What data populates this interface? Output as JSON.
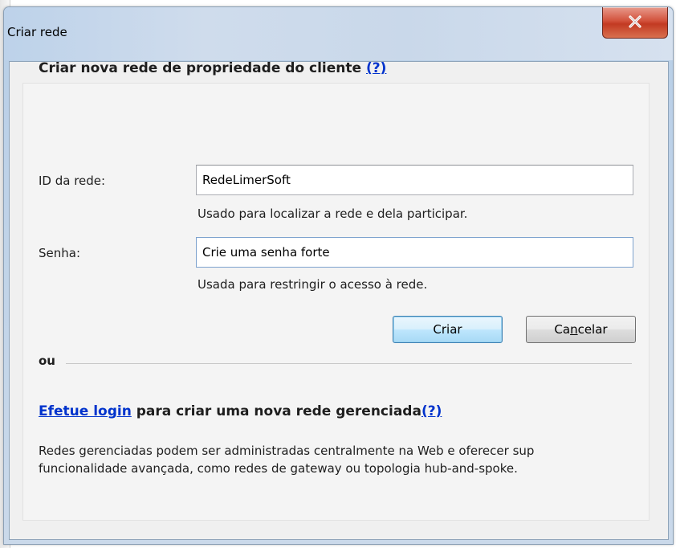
{
  "window": {
    "title": "Criar rede",
    "close_icon": "close-icon"
  },
  "form": {
    "heading": "Criar nova rede de propriedade do cliente",
    "heading_help": "(?)",
    "network_id_label": "ID da rede:",
    "network_id_value": "RedeLimerSoft",
    "network_id_hint": "Usado para localizar a rede e dela participar.",
    "password_label": "Senha:",
    "password_value": "Crie uma senha forte",
    "password_hint": "Usada para restringir o acesso à rede.",
    "create_button": "Criar",
    "cancel_button_prefix": "Ca",
    "cancel_button_mnemonic": "n",
    "cancel_button_suffix": "celar"
  },
  "managed": {
    "or_label": "ou",
    "login_link": "Efetue login",
    "login_text": " para criar uma nova rede gerenciada",
    "login_help": "(?)",
    "description_line1": "Redes gerenciadas podem ser administradas centralmente na Web e oferecer sup",
    "description_line2": "funcionalidade avançada, como redes de gateway ou topologia hub-and-spoke."
  },
  "colors": {
    "link": "#0033cc",
    "close_button": "#c23a22",
    "default_button_border": "#3c7fb1"
  }
}
